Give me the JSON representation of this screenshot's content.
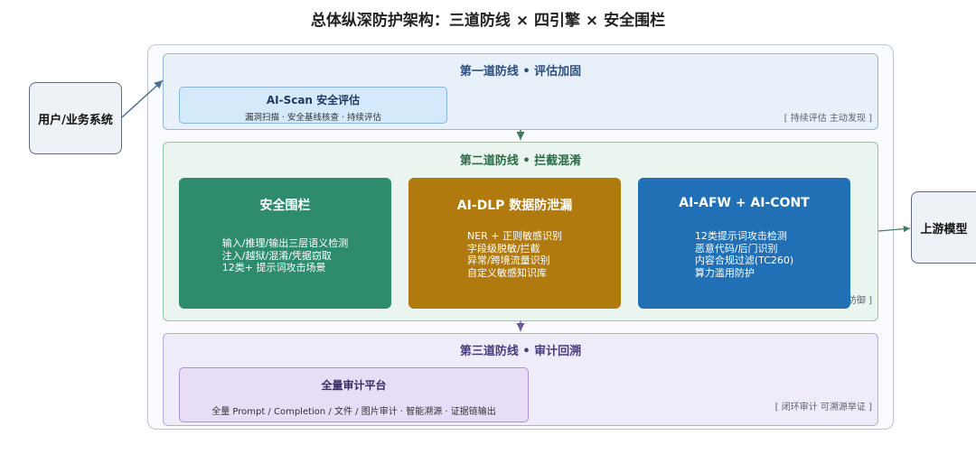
{
  "title": "总体纵深防护架构：三道防线 × 四引擎 × 安全围栏",
  "user_system": "用户/业务系统",
  "upstream_model": "上游模型",
  "layer1": {
    "title": "第一道防线 • 评估加固",
    "note": "[ 持续评估 主动发现 ]",
    "box": {
      "title": "AI-Scan 安全评估",
      "subtitle": "漏洞扫描 · 安全基线核查 · 持续评估"
    }
  },
  "layer2": {
    "title": "第二道防线 • 拦截混淆",
    "note": "[ 实时拦截 主动防御 ]",
    "cards": [
      {
        "title": "安全围栏",
        "lines": [
          "输入/推理/输出三层语义检测",
          "注入/越狱/混淆/凭据窃取",
          "12类+ 提示词攻击场景"
        ]
      },
      {
        "title": "AI-DLP 数据防泄漏",
        "lines": [
          "NER + 正则敏感识别",
          "字段级脱敏/拦截",
          "异常/跨境流量识别",
          "自定义敏感知识库"
        ]
      },
      {
        "title": "AI-AFW + AI-CONT",
        "lines": [
          "12类提示词攻击检测",
          "恶意代码/后门识别",
          "内容合规过滤(TC260)",
          "算力滥用防护"
        ]
      }
    ]
  },
  "layer3": {
    "title": "第三道防线 • 审计回溯",
    "note": "[ 闭环审计 可溯源举证 ]",
    "box": {
      "title": "全量审计平台",
      "subtitle": "全量 Prompt / Completion / 文件 / 图片审计 · 智能溯源 · 证据链输出"
    }
  },
  "colors": {
    "layer1_bg": "#e8f0f9",
    "layer2_bg": "#e9f5ee",
    "layer3_bg": "#efebf9",
    "card_green": "#2e8b6e",
    "card_gold": "#b07a0f",
    "card_blue": "#2170b5",
    "arrow": "#4a6f8f"
  }
}
